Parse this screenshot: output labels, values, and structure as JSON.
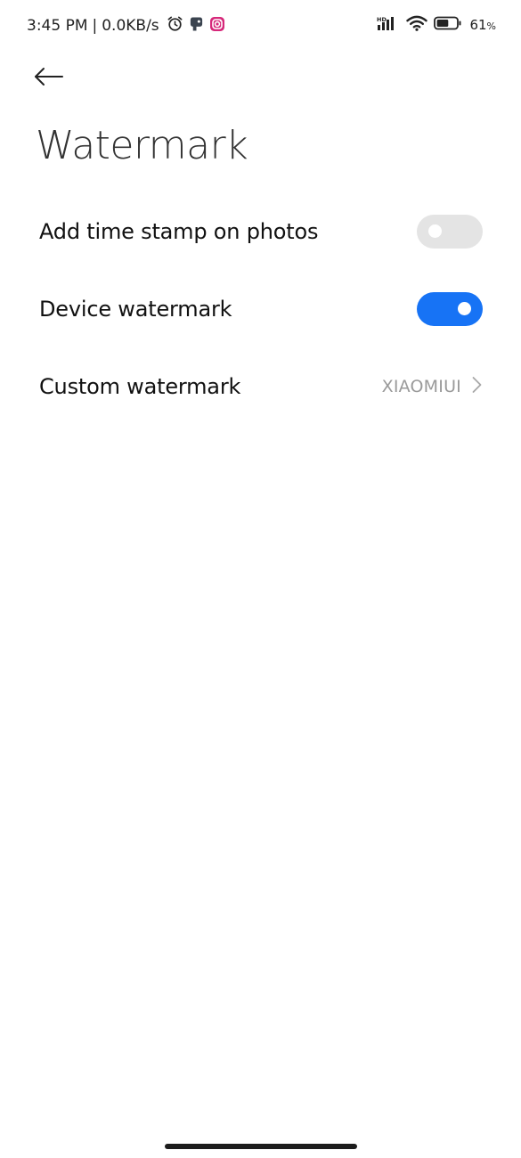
{
  "status_bar": {
    "time": "3:45 PM",
    "separator": "|",
    "network_speed": "0.0KB/s",
    "battery_percent": "61",
    "battery_unit": "%",
    "battery_level": 0.61,
    "icons_left": [
      "alarm-icon",
      "app-notification-icon",
      "instagram-icon"
    ],
    "icons_right": [
      "hd-signal-icon",
      "wifi-icon",
      "battery-icon"
    ]
  },
  "header": {
    "back_icon": "arrow-left-icon",
    "title": "Watermark"
  },
  "settings": {
    "timestamp": {
      "label": "Add time stamp on photos",
      "enabled": false
    },
    "device_watermark": {
      "label": "Device watermark",
      "enabled": true
    },
    "custom_watermark": {
      "label": "Custom watermark",
      "value": "XIAOMIUI",
      "icon": "chevron-right-icon"
    }
  },
  "colors": {
    "accent": "#1773f5",
    "toggle_off": "#e4e4e4",
    "secondary_text": "#9a9a9a",
    "instagram": "#d6287a"
  }
}
